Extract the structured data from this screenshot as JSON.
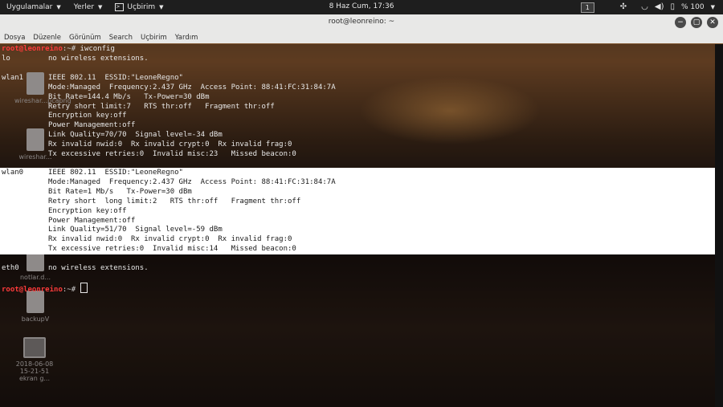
{
  "topbar": {
    "applications": "Uygulamalar",
    "places": "Yerler",
    "terminal_app": "Uçbirim",
    "clock": "8 Haz Cum, 17:36",
    "workspace": "1",
    "battery": "% 100"
  },
  "window": {
    "title": "root@leonreino: ~",
    "menu": [
      "Dosya",
      "Düzenle",
      "Görünüm",
      "Search",
      "Uçbirim",
      "Yardım"
    ]
  },
  "desktop_icons": [
    {
      "label": "wireshar...pcapng"
    },
    {
      "label": "wireshar..."
    },
    {
      "label": "notlar.d..."
    },
    {
      "label": "backupV"
    },
    {
      "label": "2018-06-08 15-21-51 ekran g..."
    }
  ],
  "terminal": {
    "prompt_user": "root@leonreino",
    "prompt_sep": ":~#",
    "command": " iwconfig",
    "lines": [
      {
        "iface": "lo",
        "text": "no wireless extensions."
      },
      {
        "iface": "",
        "text": ""
      },
      {
        "iface": "wlan1",
        "text": "IEEE 802.11  ESSID:\"LeoneRegno\""
      },
      {
        "iface": "",
        "text": "Mode:Managed  Frequency:2.437 GHz  Access Point: 88:41:FC:31:84:7A"
      },
      {
        "iface": "",
        "text": "Bit Rate=144.4 Mb/s   Tx-Power=30 dBm"
      },
      {
        "iface": "",
        "text": "Retry short limit:7   RTS thr:off   Fragment thr:off"
      },
      {
        "iface": "",
        "text": "Encryption key:off"
      },
      {
        "iface": "",
        "text": "Power Management:off"
      },
      {
        "iface": "",
        "text": "Link Quality=70/70  Signal level=-34 dBm"
      },
      {
        "iface": "",
        "text": "Rx invalid nwid:0  Rx invalid crypt:0  Rx invalid frag:0"
      },
      {
        "iface": "",
        "text": "Tx excessive retries:0  Invalid misc:23   Missed beacon:0"
      }
    ],
    "selected_lines": [
      {
        "iface": "wlan0",
        "text": "IEEE 802.11  ESSID:\"LeoneRegno\""
      },
      {
        "iface": "",
        "text": "Mode:Managed  Frequency:2.437 GHz  Access Point: 88:41:FC:31:84:7A"
      },
      {
        "iface": "",
        "text": "Bit Rate=1 Mb/s   Tx-Power=30 dBm"
      },
      {
        "iface": "",
        "text": "Retry short  long limit:2   RTS thr:off   Fragment thr:off"
      },
      {
        "iface": "",
        "text": "Encryption key:off"
      },
      {
        "iface": "",
        "text": "Power Management:off"
      },
      {
        "iface": "",
        "text": "Link Quality=51/70  Signal level=-59 dBm"
      },
      {
        "iface": "",
        "text": "Rx invalid nwid:0  Rx invalid crypt:0  Rx invalid frag:0"
      },
      {
        "iface": "",
        "text": "Tx excessive retries:0  Invalid misc:14   Missed beacon:0"
      }
    ],
    "after_lines": [
      {
        "iface": "eth0",
        "text": "no wireless extensions."
      }
    ]
  },
  "colors": {
    "prompt_user": "#ff3b3b",
    "selection_bg": "#ffffff",
    "topbar_bg": "#1e1e1e"
  }
}
